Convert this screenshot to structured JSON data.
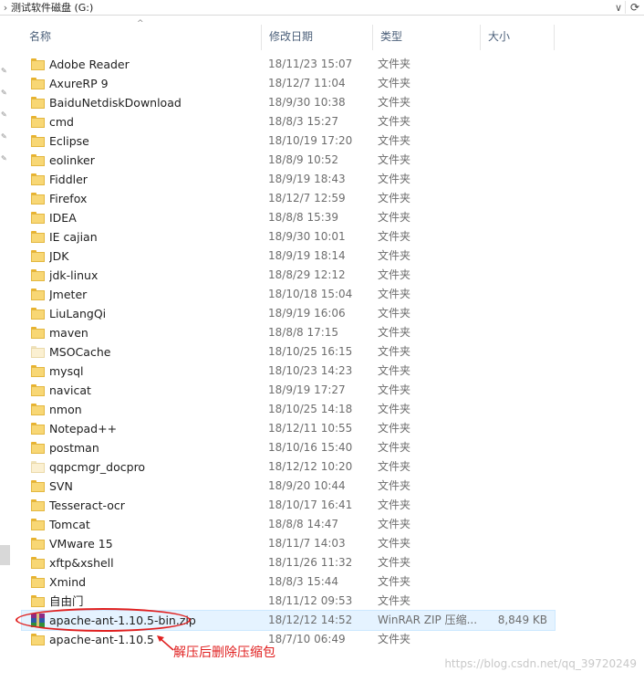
{
  "address_bar": {
    "separator": "›",
    "path": "测试软件磁盘 (G:)",
    "dropdown_glyph": "∨",
    "refresh_glyph": "⟳"
  },
  "columns": {
    "name": "名称",
    "date": "修改日期",
    "type": "类型",
    "size": "大小",
    "sort_glyph": "^"
  },
  "files": [
    {
      "name": "Adobe Reader",
      "date": "18/11/23 15:07",
      "type": "文件夹",
      "size": "",
      "icon": "folder-icon"
    },
    {
      "name": "AxureRP 9",
      "date": "18/12/7 11:04",
      "type": "文件夹",
      "size": "",
      "icon": "folder-icon"
    },
    {
      "name": "BaiduNetdiskDownload",
      "date": "18/9/30 10:38",
      "type": "文件夹",
      "size": "",
      "icon": "folder-icon"
    },
    {
      "name": "cmd",
      "date": "18/8/3 15:27",
      "type": "文件夹",
      "size": "",
      "icon": "folder-icon"
    },
    {
      "name": "Eclipse",
      "date": "18/10/19 17:20",
      "type": "文件夹",
      "size": "",
      "icon": "folder-icon"
    },
    {
      "name": "eolinker",
      "date": "18/8/9 10:52",
      "type": "文件夹",
      "size": "",
      "icon": "folder-icon"
    },
    {
      "name": "Fiddler",
      "date": "18/9/19 18:43",
      "type": "文件夹",
      "size": "",
      "icon": "folder-icon"
    },
    {
      "name": "Firefox",
      "date": "18/12/7 12:59",
      "type": "文件夹",
      "size": "",
      "icon": "folder-icon"
    },
    {
      "name": "IDEA",
      "date": "18/8/8 15:39",
      "type": "文件夹",
      "size": "",
      "icon": "folder-icon"
    },
    {
      "name": "IE cajian",
      "date": "18/9/30 10:01",
      "type": "文件夹",
      "size": "",
      "icon": "folder-icon"
    },
    {
      "name": "JDK",
      "date": "18/9/19 18:14",
      "type": "文件夹",
      "size": "",
      "icon": "folder-icon"
    },
    {
      "name": "jdk-linux",
      "date": "18/8/29 12:12",
      "type": "文件夹",
      "size": "",
      "icon": "folder-icon"
    },
    {
      "name": "Jmeter",
      "date": "18/10/18 15:04",
      "type": "文件夹",
      "size": "",
      "icon": "folder-icon"
    },
    {
      "name": "LiuLangQi",
      "date": "18/9/19 16:06",
      "type": "文件夹",
      "size": "",
      "icon": "folder-icon"
    },
    {
      "name": "maven",
      "date": "18/8/8 17:15",
      "type": "文件夹",
      "size": "",
      "icon": "folder-icon"
    },
    {
      "name": "MSOCache",
      "date": "18/10/25 16:15",
      "type": "文件夹",
      "size": "",
      "icon": "folder-hidden-icon"
    },
    {
      "name": "mysql",
      "date": "18/10/23 14:23",
      "type": "文件夹",
      "size": "",
      "icon": "folder-icon"
    },
    {
      "name": "navicat",
      "date": "18/9/19 17:27",
      "type": "文件夹",
      "size": "",
      "icon": "folder-icon"
    },
    {
      "name": "nmon",
      "date": "18/10/25 14:18",
      "type": "文件夹",
      "size": "",
      "icon": "folder-icon"
    },
    {
      "name": "Notepad++",
      "date": "18/12/11 10:55",
      "type": "文件夹",
      "size": "",
      "icon": "folder-icon"
    },
    {
      "name": "postman",
      "date": "18/10/16 15:40",
      "type": "文件夹",
      "size": "",
      "icon": "folder-icon"
    },
    {
      "name": "qqpcmgr_docpro",
      "date": "18/12/12 10:20",
      "type": "文件夹",
      "size": "",
      "icon": "folder-hidden-icon"
    },
    {
      "name": "SVN",
      "date": "18/9/20 10:44",
      "type": "文件夹",
      "size": "",
      "icon": "folder-icon"
    },
    {
      "name": "Tesseract-ocr",
      "date": "18/10/17 16:41",
      "type": "文件夹",
      "size": "",
      "icon": "folder-icon"
    },
    {
      "name": "Tomcat",
      "date": "18/8/8 14:47",
      "type": "文件夹",
      "size": "",
      "icon": "folder-icon"
    },
    {
      "name": "VMware 15",
      "date": "18/11/7 14:03",
      "type": "文件夹",
      "size": "",
      "icon": "folder-icon"
    },
    {
      "name": "xftp&xshell",
      "date": "18/11/26 11:32",
      "type": "文件夹",
      "size": "",
      "icon": "folder-icon"
    },
    {
      "name": "Xmind",
      "date": "18/8/3 15:44",
      "type": "文件夹",
      "size": "",
      "icon": "folder-icon"
    },
    {
      "name": "自由门",
      "date": "18/11/12 09:53",
      "type": "文件夹",
      "size": "",
      "icon": "folder-icon"
    },
    {
      "name": "apache-ant-1.10.5-bin.zip",
      "date": "18/12/12 14:52",
      "type": "WinRAR ZIP 压缩...",
      "size": "8,849 KB",
      "icon": "winrar-zip-icon",
      "selected": true
    },
    {
      "name": "apache-ant-1.10.5",
      "date": "18/7/10 06:49",
      "type": "文件夹",
      "size": "",
      "icon": "folder-icon"
    }
  ],
  "annotation": {
    "text": "解压后删除压缩包",
    "color": "#e02020"
  },
  "watermark": "https://blog.csdn.net/qq_39720249",
  "colors": {
    "folder": "#f8d775",
    "selection": "#e5f3ff",
    "header_text": "#4c607a"
  }
}
